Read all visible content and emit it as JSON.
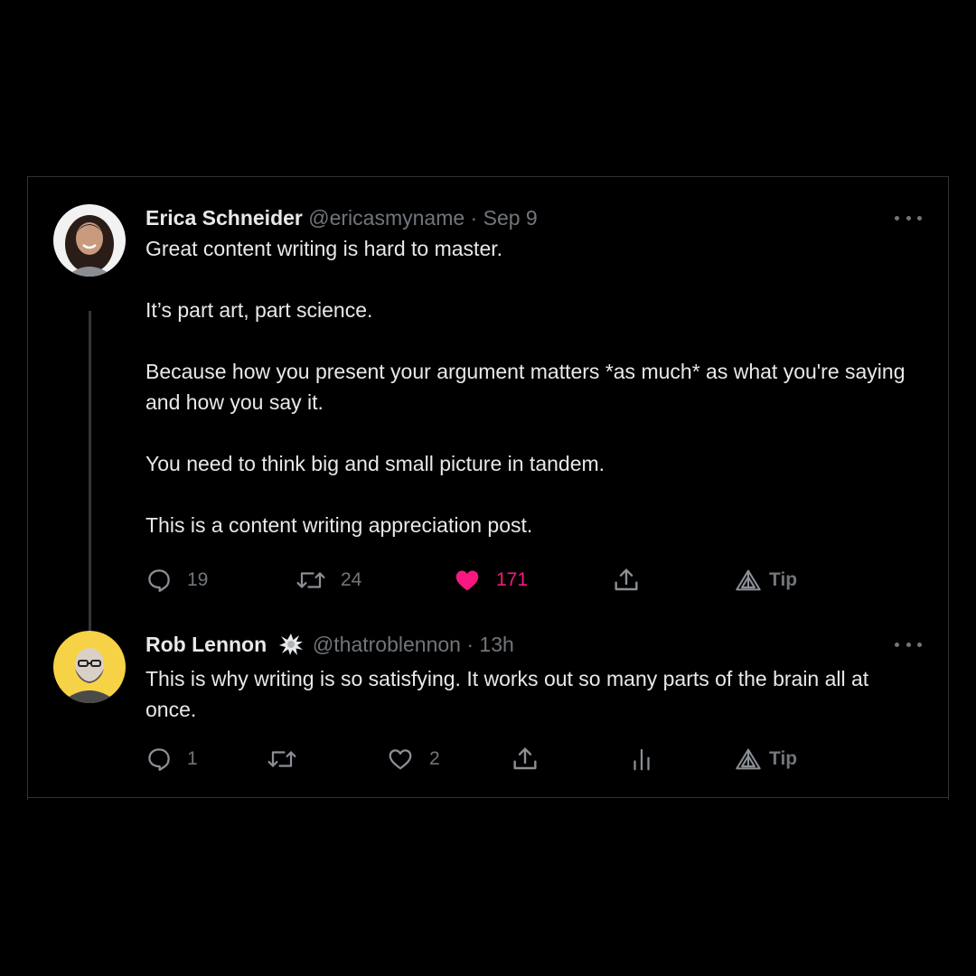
{
  "tweets": [
    {
      "author_name": "Erica Schneider",
      "handle": "@ericasmyname",
      "separator": "·",
      "time": "Sep 9",
      "paragraphs": [
        "Great content writing is hard to master.",
        "It’s part art, part science.",
        "Because how you present your argument matters *as much* as what you're saying and how you say it.",
        "You need to think big and small picture in tandem.",
        "This is a content writing appreciation post."
      ],
      "reply_count": "19",
      "retweet_count": "24",
      "like_count": "171",
      "liked": true,
      "tip_label": "Tip",
      "avatar_color": "#f2f2f2"
    },
    {
      "author_name": "Rob Lennon",
      "handle": "@thatroblennon",
      "separator": "·",
      "time": "13h",
      "paragraphs": [
        "This is why writing is so satisfying. It works out so many parts of the brain all at once."
      ],
      "reply_count": "1",
      "retweet_count": "",
      "like_count": "2",
      "liked": false,
      "tip_label": "Tip",
      "avatar_color": "#f6d246"
    }
  ],
  "colors": {
    "background": "#000000",
    "text_primary": "#e7e9ea",
    "text_secondary": "#71767b",
    "like_active": "#f91880",
    "border": "#2f3336"
  },
  "icons": {
    "more": "more-horizontal-icon",
    "reply": "reply-bubble-icon",
    "retweet": "retweet-arrows-icon",
    "like": "heart-icon",
    "share": "share-upload-icon",
    "analytics": "analytics-bars-icon",
    "tip": "tip-triangle-icon",
    "verified": "starburst-emoji-icon"
  }
}
